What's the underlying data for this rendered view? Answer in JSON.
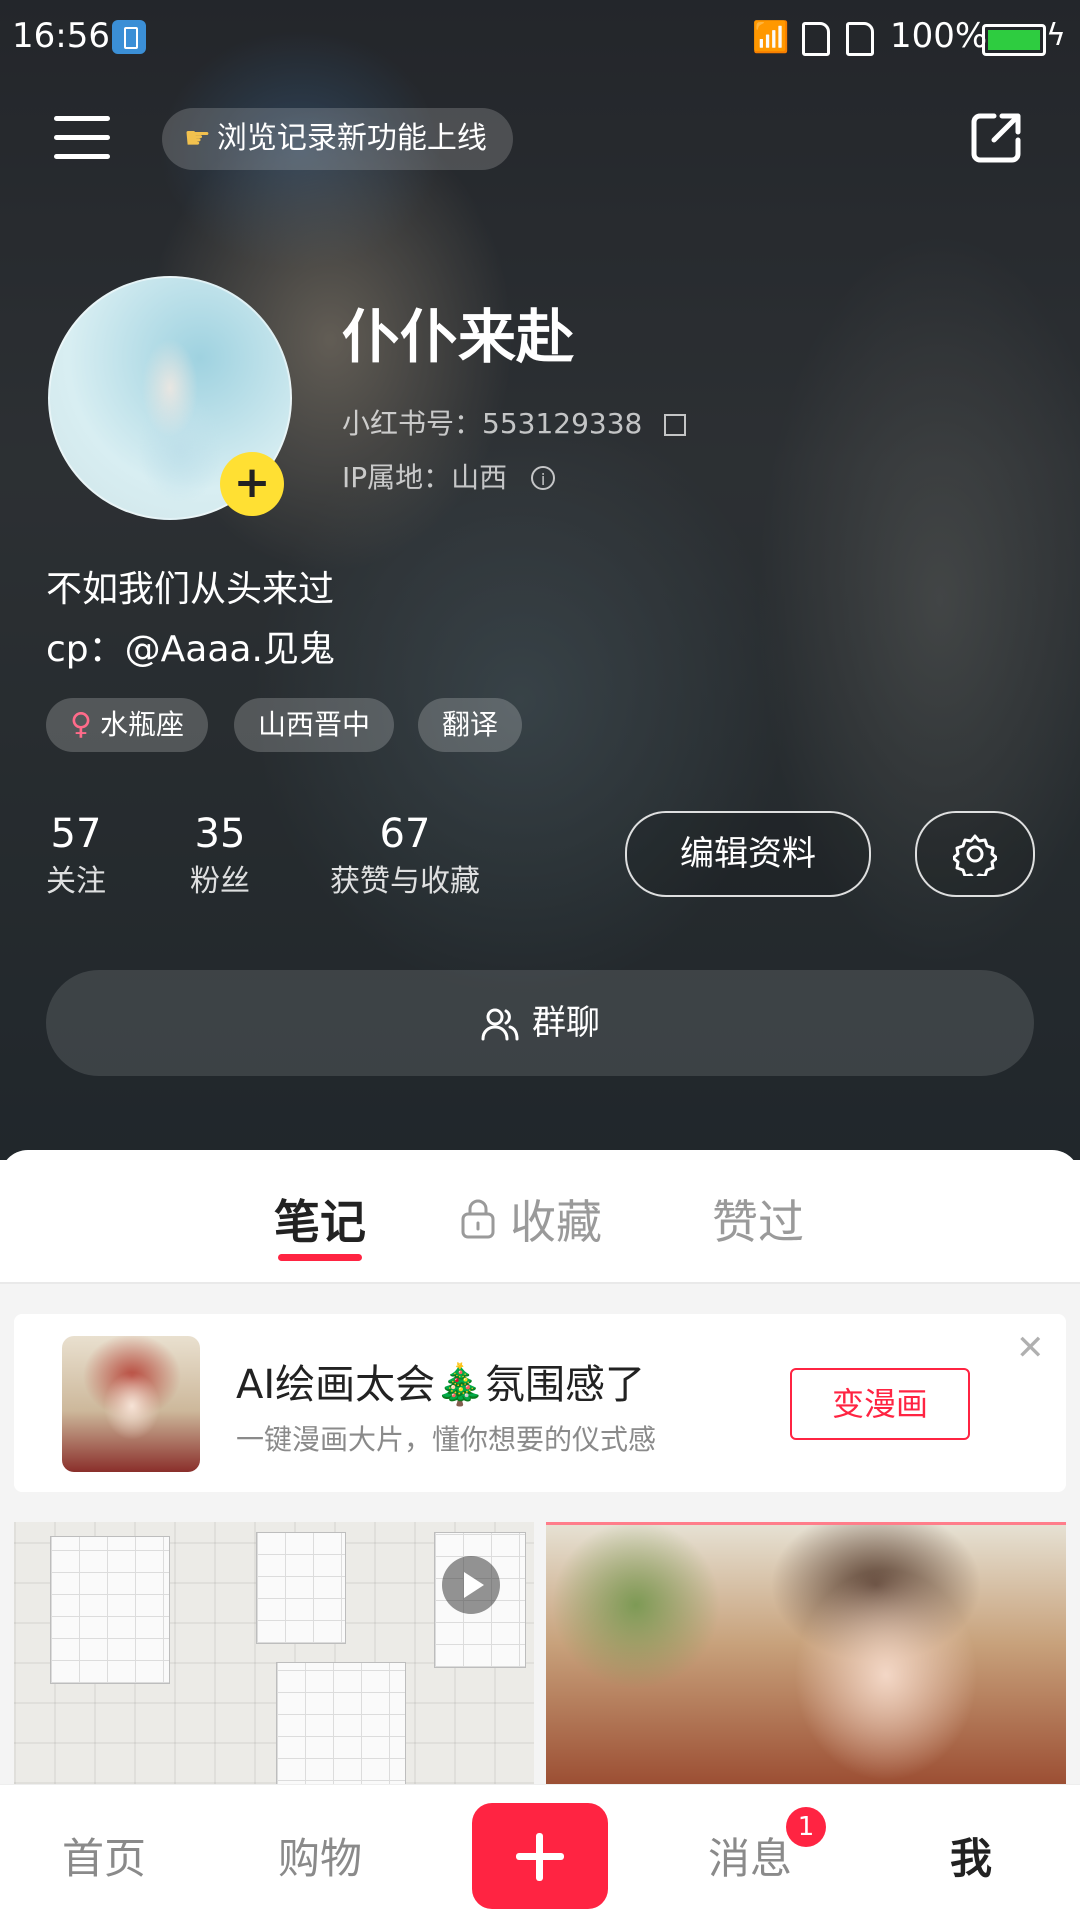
{
  "status_bar": {
    "time": "16:56",
    "battery_percent": "100%",
    "icons": [
      "battery-saver-app-icon",
      "wifi-icon",
      "sim-icon",
      "sim-icon",
      "battery-icon",
      "charging-icon"
    ]
  },
  "top_bar": {
    "menu_icon": "menu-icon",
    "banner_text": "浏览记录新功能上线",
    "banner_icon": "pointing-hand-icon",
    "share_icon": "share-icon"
  },
  "profile": {
    "name": "仆仆来赴",
    "id_label": "小红书号：553129338",
    "ip_label": "IP属地：山西",
    "bio_line1": "不如我们从头来过",
    "bio_line2": "cp：@Aaaa.见鬼",
    "tags": [
      "水瓶座",
      "山西晋中",
      "翻译"
    ],
    "stats": [
      {
        "num": "57",
        "label": "关注"
      },
      {
        "num": "35",
        "label": "粉丝"
      },
      {
        "num": "67",
        "label": "获赞与收藏"
      }
    ],
    "edit_button": "编辑资料",
    "group_chat": "群聊"
  },
  "tabs": [
    "笔记",
    "收藏",
    "赞过"
  ],
  "active_tab": "笔记",
  "ad": {
    "title": "AI绘画太会🎄氛围感了",
    "subtitle": "一键漫画大片，懂你想要的仪式感",
    "button": "变漫画"
  },
  "bottom_nav": {
    "items": [
      "首页",
      "购物",
      "消息",
      "我"
    ],
    "active": "我",
    "message_badge": "1"
  },
  "colors": {
    "accent": "#ff2442",
    "avatar_add": "#ffe033"
  }
}
